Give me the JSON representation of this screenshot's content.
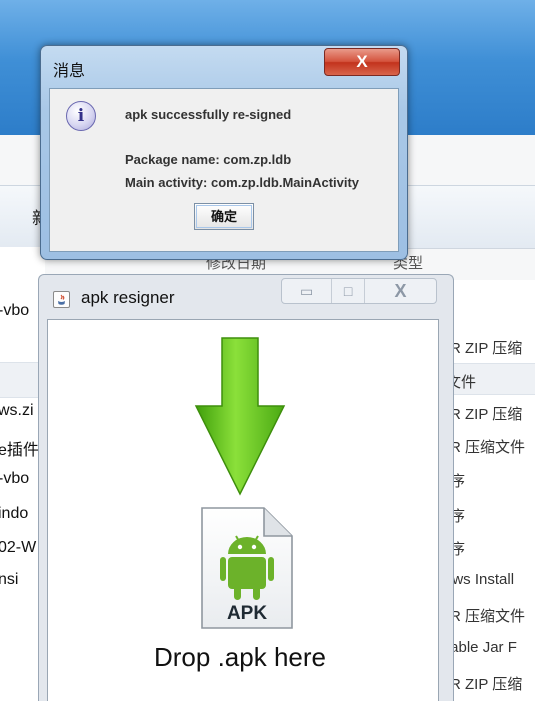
{
  "background": {
    "toolbar_label": "新",
    "column_headers": [
      "修改日期",
      "类型"
    ],
    "left_items": [
      "-vbo",
      "ws.zi",
      "e插件",
      "-vbo",
      "indo",
      "02-W",
      "nsi"
    ],
    "right_items": [
      "AR ZIP 压缩",
      "文件",
      "AR ZIP 压缩",
      "AR 压缩文件",
      "序",
      "序",
      "序",
      "ows Install",
      "AR 压缩文件",
      "table Jar F",
      "AR ZIP 压缩"
    ]
  },
  "dialog": {
    "title": "消息",
    "close_symbol": "X",
    "icon": "info-icon",
    "icon_glyph": "i",
    "message": "apk successfully re-signed",
    "package_line": "Package name: com.zp.ldb",
    "activity_line": "Main activity: com.zp.ldb.MainActivity",
    "ok_label": "确定"
  },
  "app_window": {
    "title": "apk resigner",
    "minimize_symbol": "▭",
    "maximize_symbol": "□",
    "close_symbol": "X",
    "file_badge": "APK",
    "drop_text": "Drop .apk here",
    "colors": {
      "arrow_green": "#5cbf14",
      "android_green": "#6cb22a"
    }
  }
}
